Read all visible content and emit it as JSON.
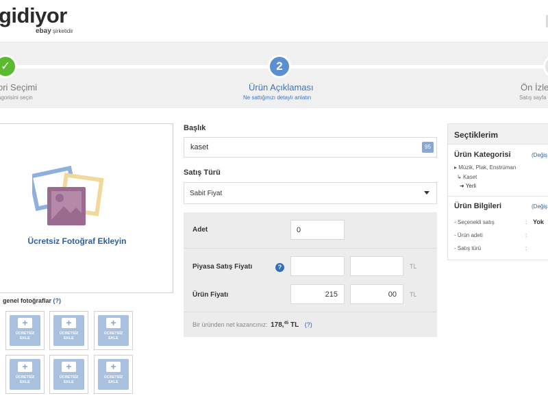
{
  "header": {
    "logo_text": "gidiyor",
    "logo_sub_brand": "ebay",
    "logo_sub_text": "şirketidir"
  },
  "steps": [
    {
      "number": "✓",
      "title": "ori Seçimi",
      "subtitle": "agorisini seçin",
      "state": "done"
    },
    {
      "number": "2",
      "title": "Ürün Açıklaması",
      "subtitle": "Ne sattığınızı detaylı anlatın",
      "state": "active"
    },
    {
      "number": "",
      "title": "Ön İzle",
      "subtitle": "Satış sayfa",
      "state": "pending"
    }
  ],
  "photo": {
    "add_label": "Ücretsiz Fotoğraf Ekleyin",
    "general_label": "genel fotoğraflar",
    "general_help": "(?)",
    "thumb_line1": "ÜCRETSİZ",
    "thumb_line2": "EKLE",
    "thumb_count": 6
  },
  "form": {
    "title_label": "Başlık",
    "title_value": "kaset",
    "title_counter": "95",
    "sale_type_label": "Satış Türü",
    "sale_type_value": "Sabit Fiyat",
    "quantity_label": "Adet",
    "quantity_value": "0",
    "market_price_label": "Piyasa Satış Fiyatı",
    "market_price_help": "?",
    "market_price_main": "",
    "market_price_cents": "",
    "price_label": "Ürün Fiyatı",
    "price_main": "215",
    "price_cents": "00",
    "currency": "TL",
    "net_text": "Bir üründen net kazancınız:",
    "net_main": "178,",
    "net_cents": "45",
    "net_currency": "TL",
    "net_help": "(?)"
  },
  "selections": {
    "title": "Seçtiklerim",
    "category_label": "Ürün Kategorisi",
    "category_change": "(Değiş",
    "category_path": [
      "Müzik, Plak, Enstrüman",
      "Kaset",
      "Yerli"
    ],
    "info_label": "Ürün Bilgileri",
    "info_change": "(Değiş",
    "info_rows": [
      {
        "label": "Seçenekli satış",
        "value": "Yok"
      },
      {
        "label": "Ürün adeti",
        "value": ""
      },
      {
        "label": "Satış türü",
        "value": ""
      }
    ]
  },
  "colors": {
    "accent": "#3c72c2",
    "done": "#5bba2e",
    "thumb": "#a9c0df"
  }
}
